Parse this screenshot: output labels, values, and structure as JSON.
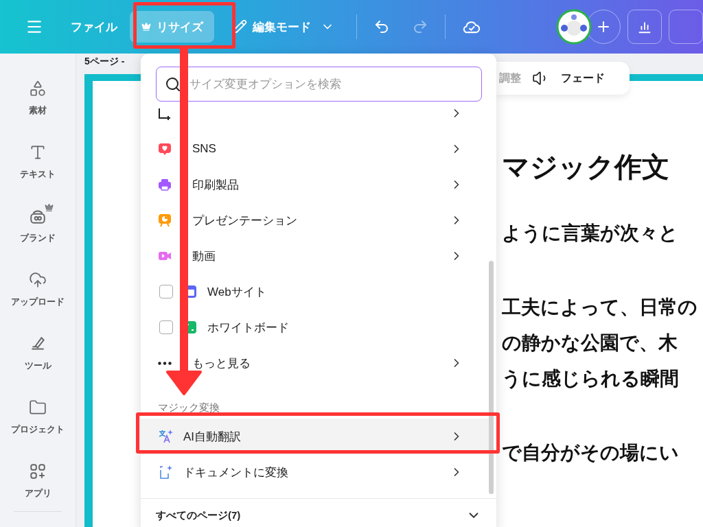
{
  "toolbar": {
    "file": "ファイル",
    "resize": {
      "label": "リサイズ",
      "premium": true,
      "selected": true
    },
    "edit_mode": "編集モード",
    "undo": {
      "disabled": false
    },
    "redo": {
      "disabled": true
    }
  },
  "sidebar": {
    "items": [
      {
        "label": "素材",
        "premium": false
      },
      {
        "label": "テキスト",
        "premium": false
      },
      {
        "label": "ブランド",
        "premium": true
      },
      {
        "label": "アップロード",
        "premium": false
      },
      {
        "label": "ツール",
        "premium": false
      },
      {
        "label": "プロジェクト",
        "premium": false
      },
      {
        "label": "アプリ",
        "premium": false
      }
    ]
  },
  "canvas": {
    "page_label": "5ページ - ",
    "floating_toolbar": [
      {
        "label": "調整",
        "disabled": true
      },
      {
        "label": "フェード",
        "disabled": false
      }
    ],
    "document": {
      "heading": "マジック作文",
      "paragraphs": [
        [
          "ように言葉が次々と"
        ],
        [
          "工夫によって、日常の",
          "の静かな公園で、木",
          "うに感じられる瞬間"
        ],
        [
          "で自分がその場にい"
        ]
      ]
    }
  },
  "resize_menu": {
    "search": {
      "placeholder": "サイズ変更オプションを検索"
    },
    "items": [
      {
        "kind": "clipped"
      },
      {
        "kind": "category",
        "label": "SNS",
        "color": "#ff4a5a",
        "selected": false
      },
      {
        "kind": "category",
        "label": "印刷製品",
        "color": "#a259ff",
        "selected": false
      },
      {
        "kind": "category",
        "label": "プレゼンテーション",
        "color": "#ff9a0a",
        "selected": false
      },
      {
        "kind": "category",
        "label": "動画",
        "color": "#e46cf0",
        "selected": false
      },
      {
        "kind": "checkbox",
        "label": "Webサイト",
        "color": "#5b67f5",
        "checked": false
      },
      {
        "kind": "checkbox",
        "label": "ホワイトボード",
        "color": "#17b86a",
        "checked": false
      },
      {
        "kind": "more",
        "label": "もっと見る",
        "selected": false
      }
    ],
    "sections": [
      {
        "title": "マジック変換",
        "items": [
          {
            "label": "AI自動翻訳",
            "selected": true
          },
          {
            "label": "ドキュメントに変換",
            "selected": false
          }
        ]
      }
    ],
    "footer": {
      "label": "すべてのページ(7)",
      "expanded": false
    }
  }
}
